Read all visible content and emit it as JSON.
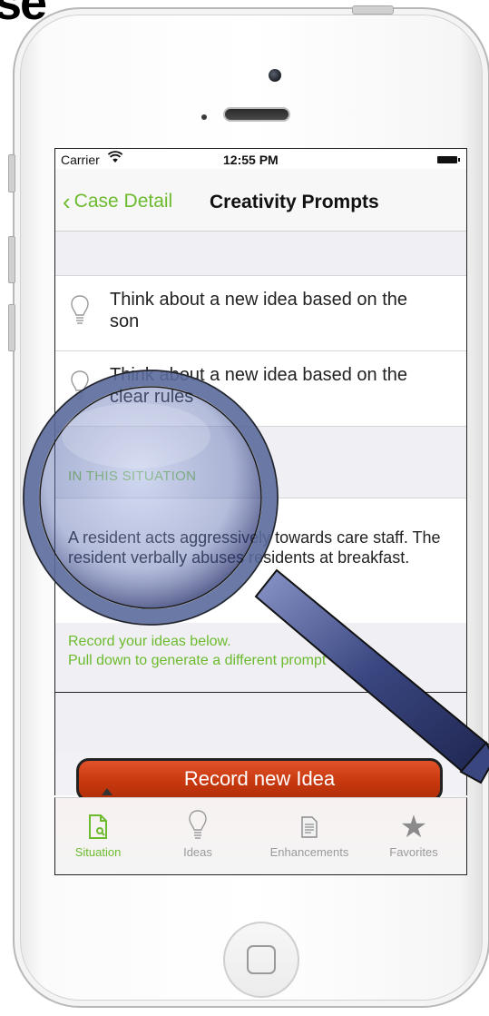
{
  "corner_text": "se",
  "status": {
    "carrier": "Carrier",
    "wifi_icon": "wifi-icon",
    "time": "12:55 PM"
  },
  "navbar": {
    "back_label": "Case Detail",
    "title": "Creativity Prompts"
  },
  "prompts": [
    {
      "text": "Think about a new idea based on the son",
      "icon": "lightbulb-icon"
    },
    {
      "text": "Think about a new idea based on the clear rules",
      "icon": "lightbulb-icon"
    }
  ],
  "situation": {
    "header": "IN THIS SITUATION",
    "text": "A resident acts aggressively towards care staff. The resident verbally abuses residents at breakfast."
  },
  "hint": {
    "line1": "Record your ideas below.",
    "line2": "Pull down to generate a different prompt"
  },
  "record_button": "Record new Idea",
  "tabs": [
    {
      "label": "Situation",
      "icon": "situation-doc-icon",
      "active": true
    },
    {
      "label": "Ideas",
      "icon": "lightbulb-icon",
      "active": false
    },
    {
      "label": "Enhancements",
      "icon": "document-icon",
      "active": false
    },
    {
      "label": "Favorites",
      "icon": "star-icon",
      "active": false
    }
  ],
  "colors": {
    "accent": "#6cbb2f",
    "record_button": "#cf3d12",
    "tab_inactive": "#9a9a9a"
  }
}
